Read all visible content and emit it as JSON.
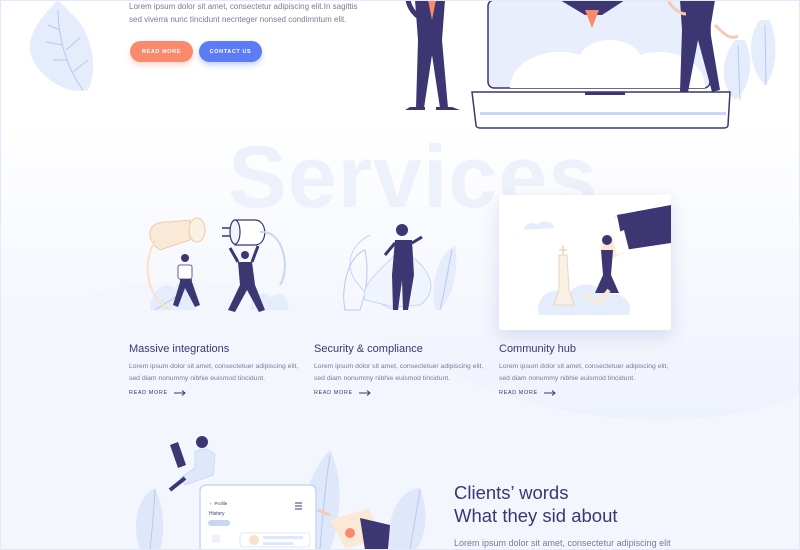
{
  "hero": {
    "text_line1": "Lorem ipsum dolor sit amet, consectetur adipiscing elit.In sagittis",
    "text_line2": "sed viverra nunc tincidunt necnteger nonsed condimntum elit.",
    "read_more": "READ MORE",
    "contact_us": "CONTACT US"
  },
  "services": {
    "watermark": "Services",
    "items": [
      {
        "title": "Massive integrations",
        "line1": "Lorem ipsum dolor sit amet, consectetuer adipiscing elit,",
        "line2": "sed diam nonummy nibhie euismod tincidunt.",
        "link": "READ MORE"
      },
      {
        "title": "Security & compliance",
        "line1": "Lorem ipsum dolor sit amet, consectetuer adipiscing elit,",
        "line2": "sed diam nonummy nibhie euismod tincidunt.",
        "link": "READ MORE"
      },
      {
        "title": "Community hub",
        "line1": "Lorem ipsum dolor sit amet, consectetuer adipiscing elit,",
        "line2": "sed diam nonummy nibhie euismod tincidunt.",
        "link": "READ MORE"
      }
    ]
  },
  "clients": {
    "title_line1": "Clients’ words",
    "title_line2": "What they sid about",
    "text": "Lorem ipsum dolor sit amet, consectetur adipiscing elit"
  },
  "phone": {
    "back_label": "Profile",
    "history_label": "History"
  },
  "colors": {
    "primary_dark": "#3c3672",
    "coral": "#f98a6e",
    "blue": "#5b7cf5",
    "light_blue": "#dfe7fb"
  }
}
